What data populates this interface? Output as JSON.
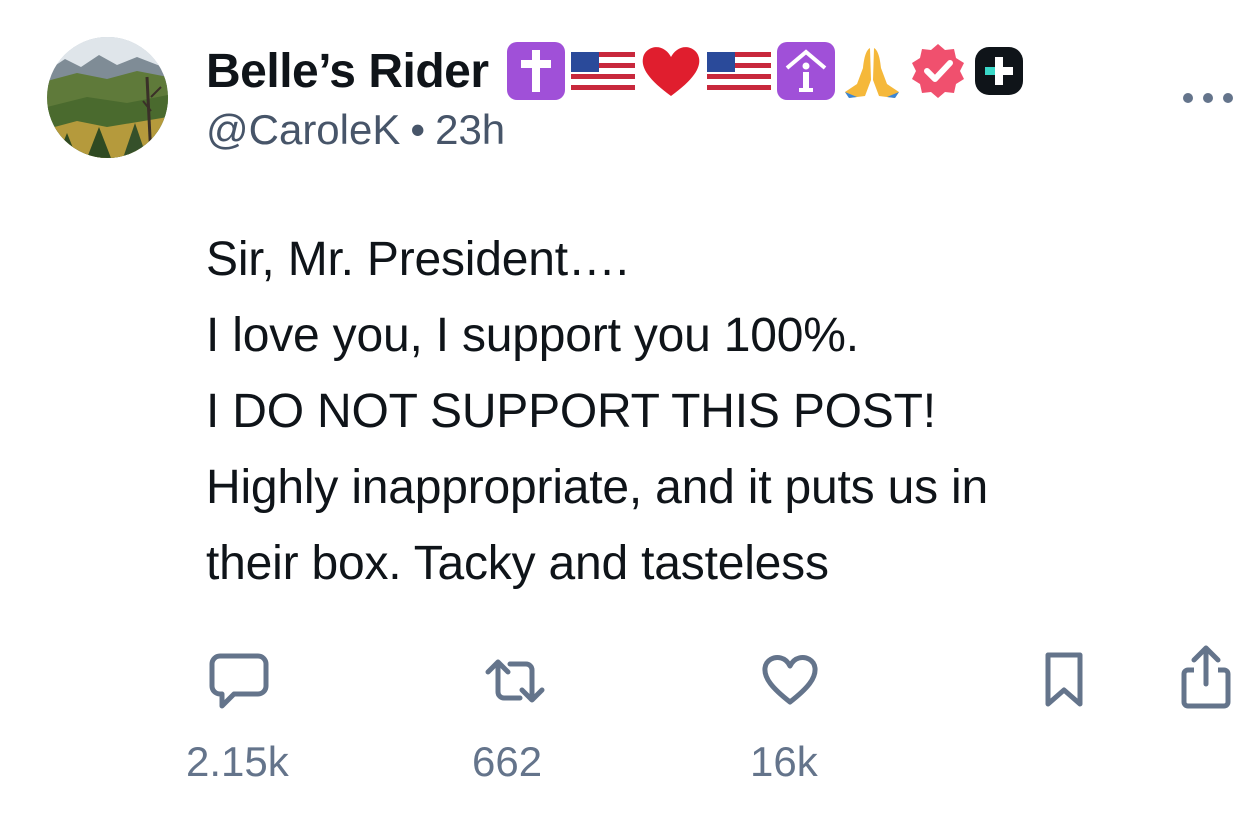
{
  "author": {
    "display_name": "Belle’s Rider",
    "handle": "@CaroleK",
    "separator": "•",
    "time_ago": "23h",
    "name_icons": [
      "latin-cross-icon",
      "us-flag-icon",
      "red-heart-icon",
      "us-flag-icon",
      "info-house-icon",
      "praying-hands-icon",
      "verified-badge-icon",
      "app-plus-badge-icon"
    ]
  },
  "post": {
    "lines": [
      "Sir, Mr. President….",
      "I love you, I support you 100%.",
      "I DO NOT SUPPORT THIS POST!",
      "Highly inappropriate, and it puts us in",
      "their box. Tacky and tasteless"
    ]
  },
  "actions": {
    "reply_count": "2.15k",
    "repost_count": "662",
    "like_count": "16k",
    "icons": [
      "reply-icon",
      "repost-icon",
      "like-icon",
      "bookmark-icon",
      "share-icon"
    ]
  },
  "colors": {
    "text": "#0f1419",
    "muted": "#64748b",
    "verified_badge": "#f0506e",
    "cross_emoji": "#a050d8"
  }
}
